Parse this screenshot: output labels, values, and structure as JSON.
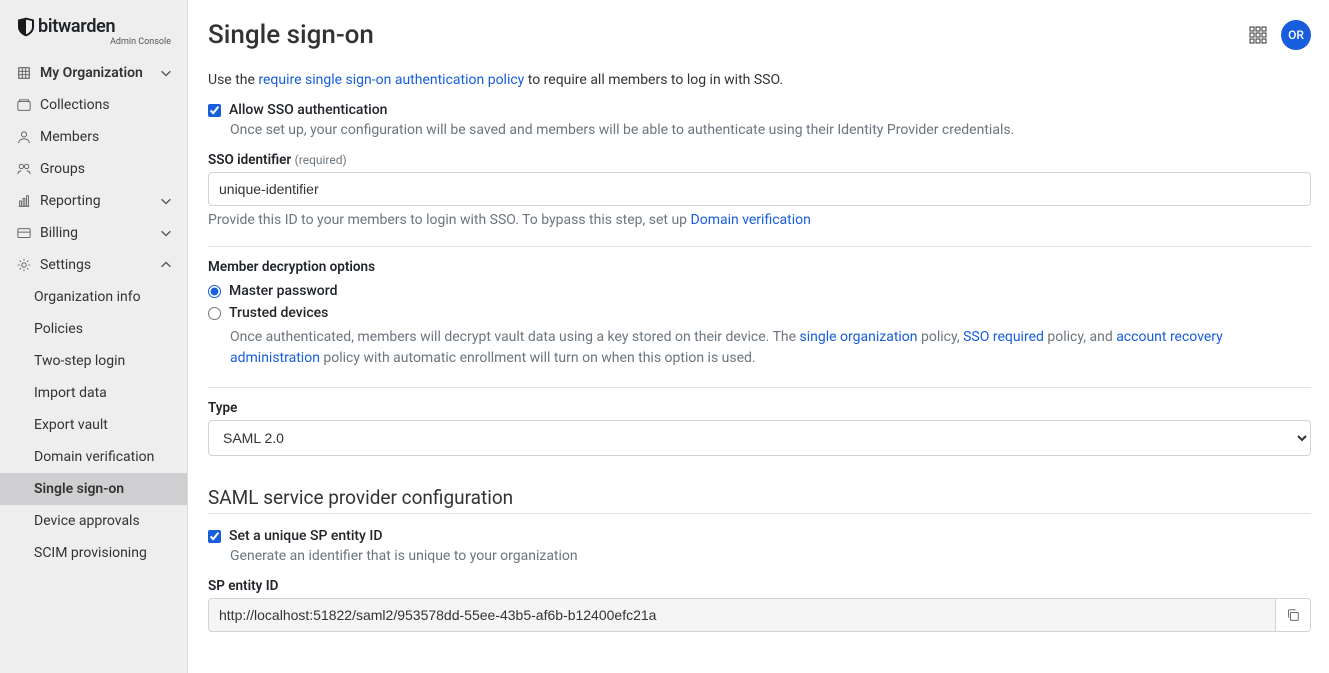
{
  "brand": {
    "name": "bitwarden",
    "subtitle": "Admin Console"
  },
  "avatar": "OR",
  "sidebar": {
    "org": "My Organization",
    "items": [
      {
        "label": "Collections"
      },
      {
        "label": "Members"
      },
      {
        "label": "Groups"
      },
      {
        "label": "Reporting"
      },
      {
        "label": "Billing"
      },
      {
        "label": "Settings"
      }
    ],
    "settingsChildren": [
      {
        "label": "Organization info"
      },
      {
        "label": "Policies"
      },
      {
        "label": "Two-step login"
      },
      {
        "label": "Import data"
      },
      {
        "label": "Export vault"
      },
      {
        "label": "Domain verification"
      },
      {
        "label": "Single sign-on"
      },
      {
        "label": "Device approvals"
      },
      {
        "label": "SCIM provisioning"
      }
    ]
  },
  "page": {
    "title": "Single sign-on",
    "intro_prefix": "Use the ",
    "intro_link": "require single sign-on authentication policy",
    "intro_suffix": " to require all members to log in with SSO.",
    "allow_label": "Allow SSO authentication",
    "allow_helper": "Once set up, your configuration will be saved and members will be able to authenticate using their Identity Provider credentials.",
    "sso_id_label": "SSO identifier",
    "required": "(required)",
    "sso_id_value": "unique-identifier",
    "sso_id_helper_prefix": "Provide this ID to your members to login with SSO. To bypass this step, set up ",
    "sso_id_helper_link": "Domain verification",
    "decrypt_section": "Member decryption options",
    "radio_master": "Master password",
    "radio_trusted": "Trusted devices",
    "trusted_helper_1": "Once authenticated, members will decrypt vault data using a key stored on their device. The ",
    "trusted_link_1": "single organization",
    "trusted_helper_2": " policy, ",
    "trusted_link_2": "SSO required",
    "trusted_helper_3": " policy, and ",
    "trusted_link_3": "account recovery administration",
    "trusted_helper_4": " policy with automatic enrollment will turn on when this option is used.",
    "type_label": "Type",
    "type_value": "SAML 2.0",
    "saml_section": "SAML service provider configuration",
    "sp_unique_label": "Set a unique SP entity ID",
    "sp_unique_helper": "Generate an identifier that is unique to your organization",
    "sp_entity_label": "SP entity ID",
    "sp_entity_value": "http://localhost:51822/saml2/953578dd-55ee-43b5-af6b-b12400efc21a"
  }
}
